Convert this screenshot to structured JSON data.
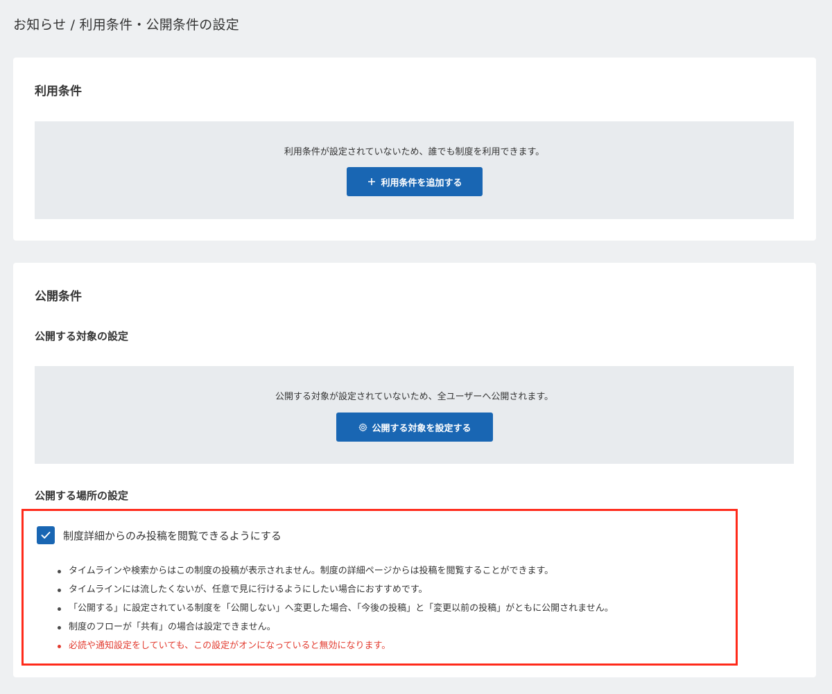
{
  "header": {
    "breadcrumb": "お知らせ / 利用条件・公開条件の設定"
  },
  "terms_section": {
    "title": "利用条件",
    "empty_message": "利用条件が設定されていないため、誰でも制度を利用できます。",
    "add_button_label": "利用条件を追加する",
    "add_button_icon": "plus-icon"
  },
  "publish_section": {
    "title": "公開条件",
    "target": {
      "heading": "公開する対象の設定",
      "empty_message": "公開する対象が設定されていないため、全ユーザーへ公開されます。",
      "button_label": "公開する対象を設定する",
      "button_icon": "gear-icon"
    },
    "location": {
      "heading": "公開する場所の設定",
      "checkbox_label": "制度詳細からのみ投稿を閲覧できるようにする",
      "checkbox_checked": true,
      "notes": [
        "タイムラインや検索からはこの制度の投稿が表示されません。制度の詳細ページからは投稿を閲覧することができます。",
        "タイムラインには流したくないが、任意で見に行けるようにしたい場合におすすめです。",
        "「公開する」に設定されている制度を「公開しない」へ変更した場合、「今後の投稿」と「変更以前の投稿」がともに公開されません。",
        "制度のフローが「共有」の場合は設定できません。",
        "必読や通知設定をしていても、この設定がオンになっていると無効になります。"
      ]
    }
  },
  "colors": {
    "primary": "#1966b3",
    "highlight_border": "#ff2a1a",
    "warning_text": "#e23a2e",
    "page_background": "#eef0f2",
    "empty_box_background": "#e8ebee"
  }
}
